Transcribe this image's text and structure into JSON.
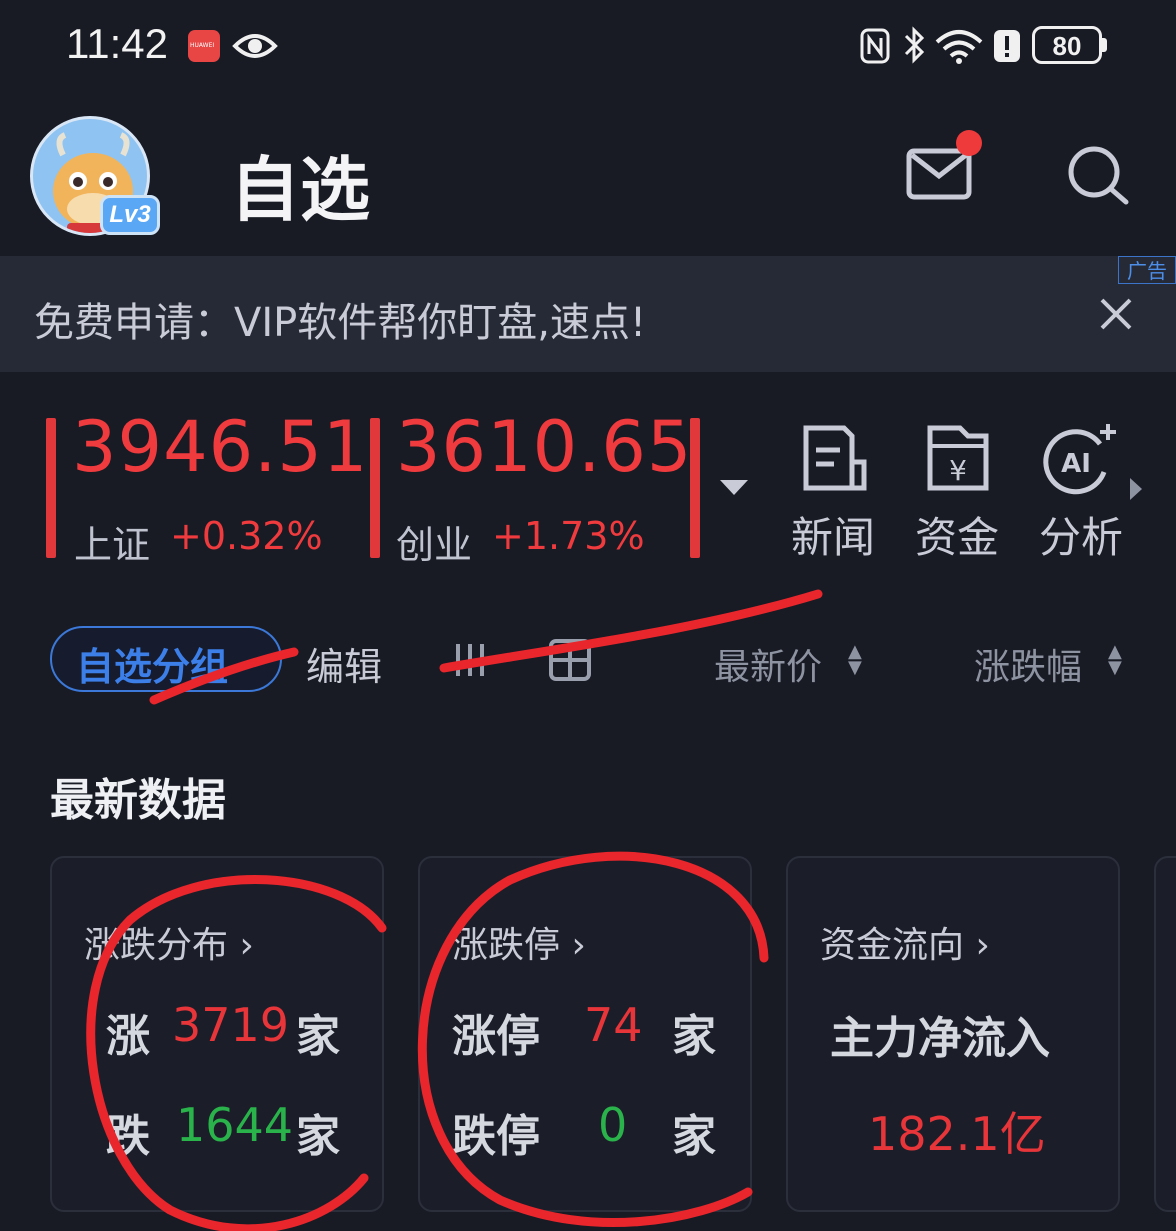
{
  "status_bar": {
    "time": "11:42",
    "app_icon_text": "HUAWEI",
    "battery": "80",
    "icons": [
      "huawei-app-icon",
      "eye-icon",
      "nfc-icon",
      "bluetooth-icon",
      "wifi-icon",
      "alert-icon",
      "battery-icon"
    ]
  },
  "header": {
    "title": "自选",
    "avatar_level": "Lv3",
    "icons": [
      "mail-icon",
      "search-icon"
    ],
    "notification_dot_color": "#ee3a3a"
  },
  "ad": {
    "text": "免费申请：VIP软件帮你盯盘,速点!",
    "tag": "广告"
  },
  "indices": [
    {
      "value": "3946.51",
      "name": "上证",
      "change": "+0.32%"
    },
    {
      "value": "3610.65",
      "name": "创业",
      "change": "+1.73%"
    }
  ],
  "quick_actions": [
    {
      "label": "新闻",
      "icon": "news-icon"
    },
    {
      "label": "资金",
      "icon": "funds-icon"
    },
    {
      "label": "分析",
      "icon": "ai-analysis-icon"
    }
  ],
  "toolbar": {
    "group_label": "自选分组",
    "edit_label": "编辑",
    "sort_price_label": "最新价",
    "sort_change_label": "涨跌幅"
  },
  "section": {
    "title": "最新数据"
  },
  "cards": {
    "distribution": {
      "title": "涨跌分布",
      "up_label": "涨",
      "up_count": "3719",
      "down_label": "跌",
      "down_count": "1644",
      "unit": "家"
    },
    "limits": {
      "title": "涨跌停",
      "up_label": "涨停",
      "up_count": "74",
      "down_label": "跌停",
      "down_count": "0",
      "unit": "家"
    },
    "fund_flow": {
      "title": "资金流向",
      "label": "主力净流入",
      "value": "182.1亿"
    }
  },
  "colors": {
    "background": "#181a24",
    "up_red": "#e8353a",
    "down_green": "#29b34a",
    "accent_blue": "#3c7fe8",
    "annotation_red": "#e8262c"
  }
}
